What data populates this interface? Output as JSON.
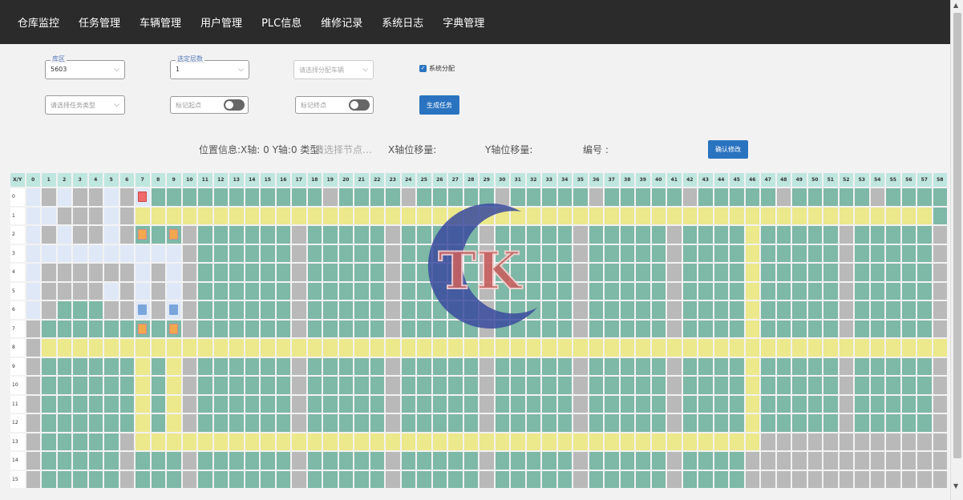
{
  "nav": {
    "items": [
      "仓库监控",
      "任务管理",
      "车辆管理",
      "用户管理",
      "PLC信息",
      "维修记录",
      "系统日志",
      "字典管理"
    ]
  },
  "filters": {
    "warehouse": {
      "legend": "库区",
      "value": "5603"
    },
    "floor": {
      "legend": "选定层数",
      "value": "1"
    },
    "vehicle": {
      "placeholder": "请选择分配车辆"
    },
    "task_type": {
      "placeholder": "请选择任务类型"
    },
    "start_point": {
      "label": "标记起点"
    },
    "end_point": {
      "label": "标记终点"
    },
    "system_assign": {
      "label": "系统分配",
      "checked": true
    },
    "generate_button": "生成任务"
  },
  "position": {
    "info": "位置信息:X轴: 0 Y轴:0 类型:",
    "type_placeholder": "请选择节点…",
    "x_offset": "X轴位移量:",
    "y_offset": "Y轴位移量:",
    "number": "编号 :",
    "confirm_button": "确认修改"
  },
  "grid": {
    "corner": "X/Y",
    "columns": 59,
    "rows": 16,
    "legend_colors": {
      "green": "#7eb8a6",
      "gray": "#b9b9b9",
      "yellow": "#ece88c",
      "light_blue": "#dfe8f6"
    },
    "cell_map": [
      "BSBSSBSR?GGGGGGGGGGSGGGGSGGGGGSGGGGGSGGGGGSGGGGGSGGGGGSGGG",
      "BBSSSBSYYYYYYYYYYYYYYYYYYYYYYYYYYYYYYYYYYYYYYYYYYYYYYYYYYY",
      "BSBSSBSOGOSGGGGGGSGGGGGSGGGGGSGGGGGSGGGGGSGGGGYGGGGGSGGGGGS",
      "BBBBBBBBBBSGGGGGGSGGGGGSGGGGGSGGGGGSGGGGGSGGGGYGGGGGSGGGGGS",
      "BSSSSSSBSBSGGGGGGSGGGGGSGGGGGSGGGGGSGGGGGSGGGGYGGGGGSGGGGGS",
      "BSSSSBSBSBSGGGGGGSGGGGGSGGGGGSGGGGGSGGGGGSGGGGYGGGGGSGGGGGS",
      "BSGGGSSLSLSGGGGGGSGGGGGSGGGGGSGGGGGSGGGGGSGGGGYGGGGGSGGGGGS",
      "SGGGGGGOGOSGGGGGGSGGGGGSGGGGGSGGGGGSGGGGGSGGGGYGGGGGSGGGGGS",
      "SYYYYYYYYYYYYYYYYYYYYYYYYYYYYYYYYYYYYYYYYYYYYYYYYYYYYYYYYYY",
      "SGGGGGGYGYSGGGGGGSGGGGGSGGGGGSGGGGGSGGGGGSGGGGYGGGGGSGGGGGS",
      "SGGGGGGYGYSGGGGGGSGGGGGSGGGGGSGGGGGSGGGGGSGGGGYGGGGGSGGGGGS",
      "SGGGGGGYGYSGGGGGGSGGGGGSGGGGGSGGGGGSGGGGGSGGGGYGGGGGSGGGGGS",
      "SGGGGGGYGYSGGGGGGSGGGGGSGGGGGSGGGGGSGGGGGSGGGGYGGGGGSGGGGGS",
      "SGGGGGSYYYYYYYYYYYYYYYYYYYYYYYYYYYYYYYYYYYYYYYYSSSSSSSSSSSS",
      "SGGGGGSGGGSGGGGGGSGGGGGSGGGGGSGGGGGSGGGGGSGGGGSSSSSSSSSSSSS",
      "SGGGGGSGGGSGGGGGGSGGGGGSGGGGGSGGGGGSGGGGGSGGGGSSSSSSSSSSSSS"
    ]
  },
  "logo": {
    "text": "TK"
  }
}
